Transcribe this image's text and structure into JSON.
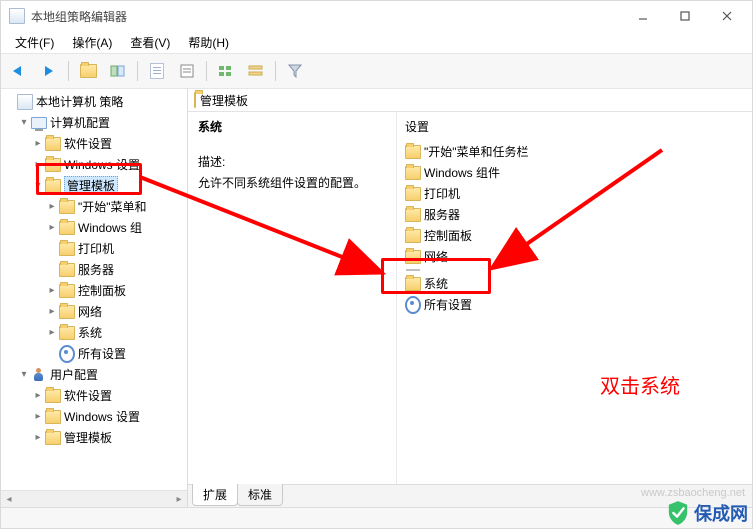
{
  "window": {
    "title": "本地组策略编辑器"
  },
  "menu": {
    "file": "文件(F)",
    "action": "操作(A)",
    "view": "查看(V)",
    "help": "帮助(H)"
  },
  "tree": {
    "root": "本地计算机 策略",
    "computer": "计算机配置",
    "c_soft": "软件设置",
    "c_winset": "Windows 设置",
    "c_admin": "管理模板",
    "c_admin_sub": {
      "start": "\"开始\"菜单和",
      "wincomp": "Windows 组",
      "printer": "打印机",
      "server": "服务器",
      "ctrlpanel": "控制面板",
      "network": "网络",
      "system": "系统",
      "allset": "所有设置"
    },
    "user": "用户配置",
    "u_soft": "软件设置",
    "u_winset": "Windows 设置",
    "u_admin": "管理模板"
  },
  "right": {
    "path": "管理模板",
    "section": "系统",
    "desc_label": "描述:",
    "desc_text": "允许不同系统组件设置的配置。",
    "items_header": "设置",
    "items": {
      "start": "\"开始\"菜单和任务栏",
      "wincomp": "Windows 组件",
      "printer": "打印机",
      "server": "服务器",
      "ctrlpanel": "控制面板",
      "network": "网络",
      "system": "系统",
      "allset": "所有设置"
    }
  },
  "tabs": {
    "extended": "扩展",
    "standard": "标准"
  },
  "annot": {
    "tip": "双击系统"
  },
  "watermark": {
    "brand": "保成网",
    "url": "www.zsbaocheng.net"
  }
}
